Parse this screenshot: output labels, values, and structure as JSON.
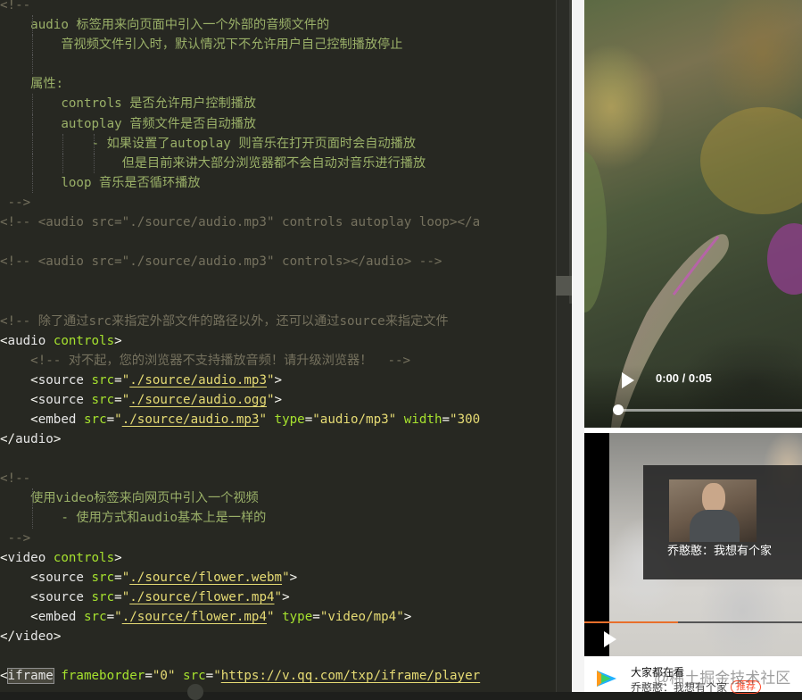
{
  "editor": {
    "lines": [
      [
        {
          "cls": "c",
          "text": "<!--"
        }
      ],
      [
        {
          "cls": "c",
          "text": "    "
        },
        {
          "cls": "cg",
          "text": "audio 标签用来向页面中引入一个外部的音频文件的"
        }
      ],
      [
        {
          "cls": "cg",
          "text": "        音视频文件引入时，默认情况下不允许用户自己控制播放停止"
        }
      ],
      [
        {
          "cls": "c",
          "text": ""
        }
      ],
      [
        {
          "cls": "cg",
          "text": "    属性:"
        }
      ],
      [
        {
          "cls": "cg",
          "text": "        controls 是否允许用户控制播放"
        }
      ],
      [
        {
          "cls": "cg",
          "text": "        autoplay 音频文件是否自动播放"
        }
      ],
      [
        {
          "cls": "cg",
          "text": "            - 如果设置了autoplay 则音乐在打开页面时会自动播放"
        }
      ],
      [
        {
          "cls": "cg",
          "text": "                但是目前来讲大部分浏览器都不会自动对音乐进行播放"
        }
      ],
      [
        {
          "cls": "cg",
          "text": "        loop 音乐是否循环播放"
        }
      ],
      [
        {
          "cls": "c",
          "text": " -->"
        }
      ],
      [
        {
          "cls": "c",
          "text": "<!-- <audio src=\"./source/audio.mp3\" controls autoplay loop></a"
        }
      ],
      [
        {
          "cls": "c",
          "text": ""
        }
      ],
      [
        {
          "cls": "c",
          "text": "<!-- <audio src=\"./source/audio.mp3\" controls></audio> -->"
        }
      ],
      [
        {
          "cls": "c",
          "text": ""
        }
      ],
      [
        {
          "cls": "c",
          "text": ""
        }
      ],
      [
        {
          "cls": "c",
          "text": "<!-- 除了通过src来指定外部文件的路径以外，还可以通过source来指定文件"
        }
      ],
      [
        {
          "cls": "t",
          "text": "<"
        },
        {
          "cls": "tn",
          "text": "audio"
        },
        {
          "cls": "t",
          "text": " "
        },
        {
          "cls": "a",
          "text": "controls"
        },
        {
          "cls": "t",
          "text": ">"
        }
      ],
      [
        {
          "cls": "c",
          "text": "    <!-- 对不起，您的浏览器不支持播放音频！请升级浏览器！  -->"
        }
      ],
      [
        {
          "cls": "t",
          "text": "    <"
        },
        {
          "cls": "tn",
          "text": "source"
        },
        {
          "cls": "t",
          "text": " "
        },
        {
          "cls": "a",
          "text": "src"
        },
        {
          "cls": "t",
          "text": "="
        },
        {
          "cls": "s",
          "text": "\""
        },
        {
          "cls": "su",
          "text": "./source/audio.mp3"
        },
        {
          "cls": "s",
          "text": "\""
        },
        {
          "cls": "t",
          "text": ">"
        }
      ],
      [
        {
          "cls": "t",
          "text": "    <"
        },
        {
          "cls": "tn",
          "text": "source"
        },
        {
          "cls": "t",
          "text": " "
        },
        {
          "cls": "a",
          "text": "src"
        },
        {
          "cls": "t",
          "text": "="
        },
        {
          "cls": "s",
          "text": "\""
        },
        {
          "cls": "su",
          "text": "./source/audio.ogg"
        },
        {
          "cls": "s",
          "text": "\""
        },
        {
          "cls": "t",
          "text": ">"
        }
      ],
      [
        {
          "cls": "t",
          "text": "    <"
        },
        {
          "cls": "tn",
          "text": "embed"
        },
        {
          "cls": "t",
          "text": " "
        },
        {
          "cls": "a",
          "text": "src"
        },
        {
          "cls": "t",
          "text": "="
        },
        {
          "cls": "s",
          "text": "\""
        },
        {
          "cls": "su",
          "text": "./source/audio.mp3"
        },
        {
          "cls": "s",
          "text": "\""
        },
        {
          "cls": "t",
          "text": " "
        },
        {
          "cls": "a",
          "text": "type"
        },
        {
          "cls": "t",
          "text": "="
        },
        {
          "cls": "s",
          "text": "\"audio/mp3\""
        },
        {
          "cls": "t",
          "text": " "
        },
        {
          "cls": "a",
          "text": "width"
        },
        {
          "cls": "t",
          "text": "="
        },
        {
          "cls": "s",
          "text": "\"300"
        }
      ],
      [
        {
          "cls": "t",
          "text": "</"
        },
        {
          "cls": "tn",
          "text": "audio"
        },
        {
          "cls": "t",
          "text": ">"
        }
      ],
      [
        {
          "cls": "c",
          "text": ""
        }
      ],
      [
        {
          "cls": "c",
          "text": "<!--"
        }
      ],
      [
        {
          "cls": "cg",
          "text": "    使用video标签来向网页中引入一个视频"
        }
      ],
      [
        {
          "cls": "cg",
          "text": "        - 使用方式和audio基本上是一样的"
        }
      ],
      [
        {
          "cls": "c",
          "text": " -->"
        }
      ],
      [
        {
          "cls": "t",
          "text": "<"
        },
        {
          "cls": "tn",
          "text": "video"
        },
        {
          "cls": "t",
          "text": " "
        },
        {
          "cls": "a",
          "text": "controls"
        },
        {
          "cls": "t",
          "text": ">"
        }
      ],
      [
        {
          "cls": "t",
          "text": "    <"
        },
        {
          "cls": "tn",
          "text": "source"
        },
        {
          "cls": "t",
          "text": " "
        },
        {
          "cls": "a",
          "text": "src"
        },
        {
          "cls": "t",
          "text": "="
        },
        {
          "cls": "s",
          "text": "\""
        },
        {
          "cls": "su",
          "text": "./source/flower.webm"
        },
        {
          "cls": "s",
          "text": "\""
        },
        {
          "cls": "t",
          "text": ">"
        }
      ],
      [
        {
          "cls": "t",
          "text": "    <"
        },
        {
          "cls": "tn",
          "text": "source"
        },
        {
          "cls": "t",
          "text": " "
        },
        {
          "cls": "a",
          "text": "src"
        },
        {
          "cls": "t",
          "text": "="
        },
        {
          "cls": "s",
          "text": "\""
        },
        {
          "cls": "su",
          "text": "./source/flower.mp4"
        },
        {
          "cls": "s",
          "text": "\""
        },
        {
          "cls": "t",
          "text": ">"
        }
      ],
      [
        {
          "cls": "t",
          "text": "    <"
        },
        {
          "cls": "tn",
          "text": "embed"
        },
        {
          "cls": "t",
          "text": " "
        },
        {
          "cls": "a",
          "text": "src"
        },
        {
          "cls": "t",
          "text": "="
        },
        {
          "cls": "s",
          "text": "\""
        },
        {
          "cls": "su",
          "text": "./source/flower.mp4"
        },
        {
          "cls": "s",
          "text": "\""
        },
        {
          "cls": "t",
          "text": " "
        },
        {
          "cls": "a",
          "text": "type"
        },
        {
          "cls": "t",
          "text": "="
        },
        {
          "cls": "s",
          "text": "\"video/mp4\""
        },
        {
          "cls": "t",
          "text": ">"
        }
      ],
      [
        {
          "cls": "t",
          "text": "</"
        },
        {
          "cls": "tn",
          "text": "video"
        },
        {
          "cls": "t",
          "text": ">"
        }
      ],
      [
        {
          "cls": "c",
          "text": ""
        }
      ],
      [
        {
          "cls": "t",
          "text": "<"
        },
        {
          "cls": "tn hl",
          "text": "iframe"
        },
        {
          "cls": "t",
          "text": " "
        },
        {
          "cls": "a",
          "text": "frameborder"
        },
        {
          "cls": "t",
          "text": "="
        },
        {
          "cls": "s",
          "text": "\"0\""
        },
        {
          "cls": "t",
          "text": " "
        },
        {
          "cls": "a",
          "text": "src"
        },
        {
          "cls": "t",
          "text": "="
        },
        {
          "cls": "s",
          "text": "\""
        },
        {
          "cls": "su",
          "text": "https://v.qq.com/txp/iframe/player"
        }
      ]
    ]
  },
  "video1": {
    "time_label": "0:00 / 0:05",
    "progress": 0
  },
  "iframe_player": {
    "caption": "乔憨憨：我想有个家",
    "bottom_line1": "大家都在看",
    "bottom_line2": "乔憨憨：我想有个家",
    "badge": "推荐",
    "watermark": "@稀土掘金技术社区",
    "progress": 0.43
  },
  "colors": {
    "editor_bg": "#272822",
    "comment": "#75715e",
    "comment_text": "#9ab068",
    "attr": "#a6e22e",
    "string": "#e6db74",
    "accent_orange": "#e86f2b"
  },
  "icons": [
    "play-icon",
    "tencent-video-logo-icon"
  ]
}
